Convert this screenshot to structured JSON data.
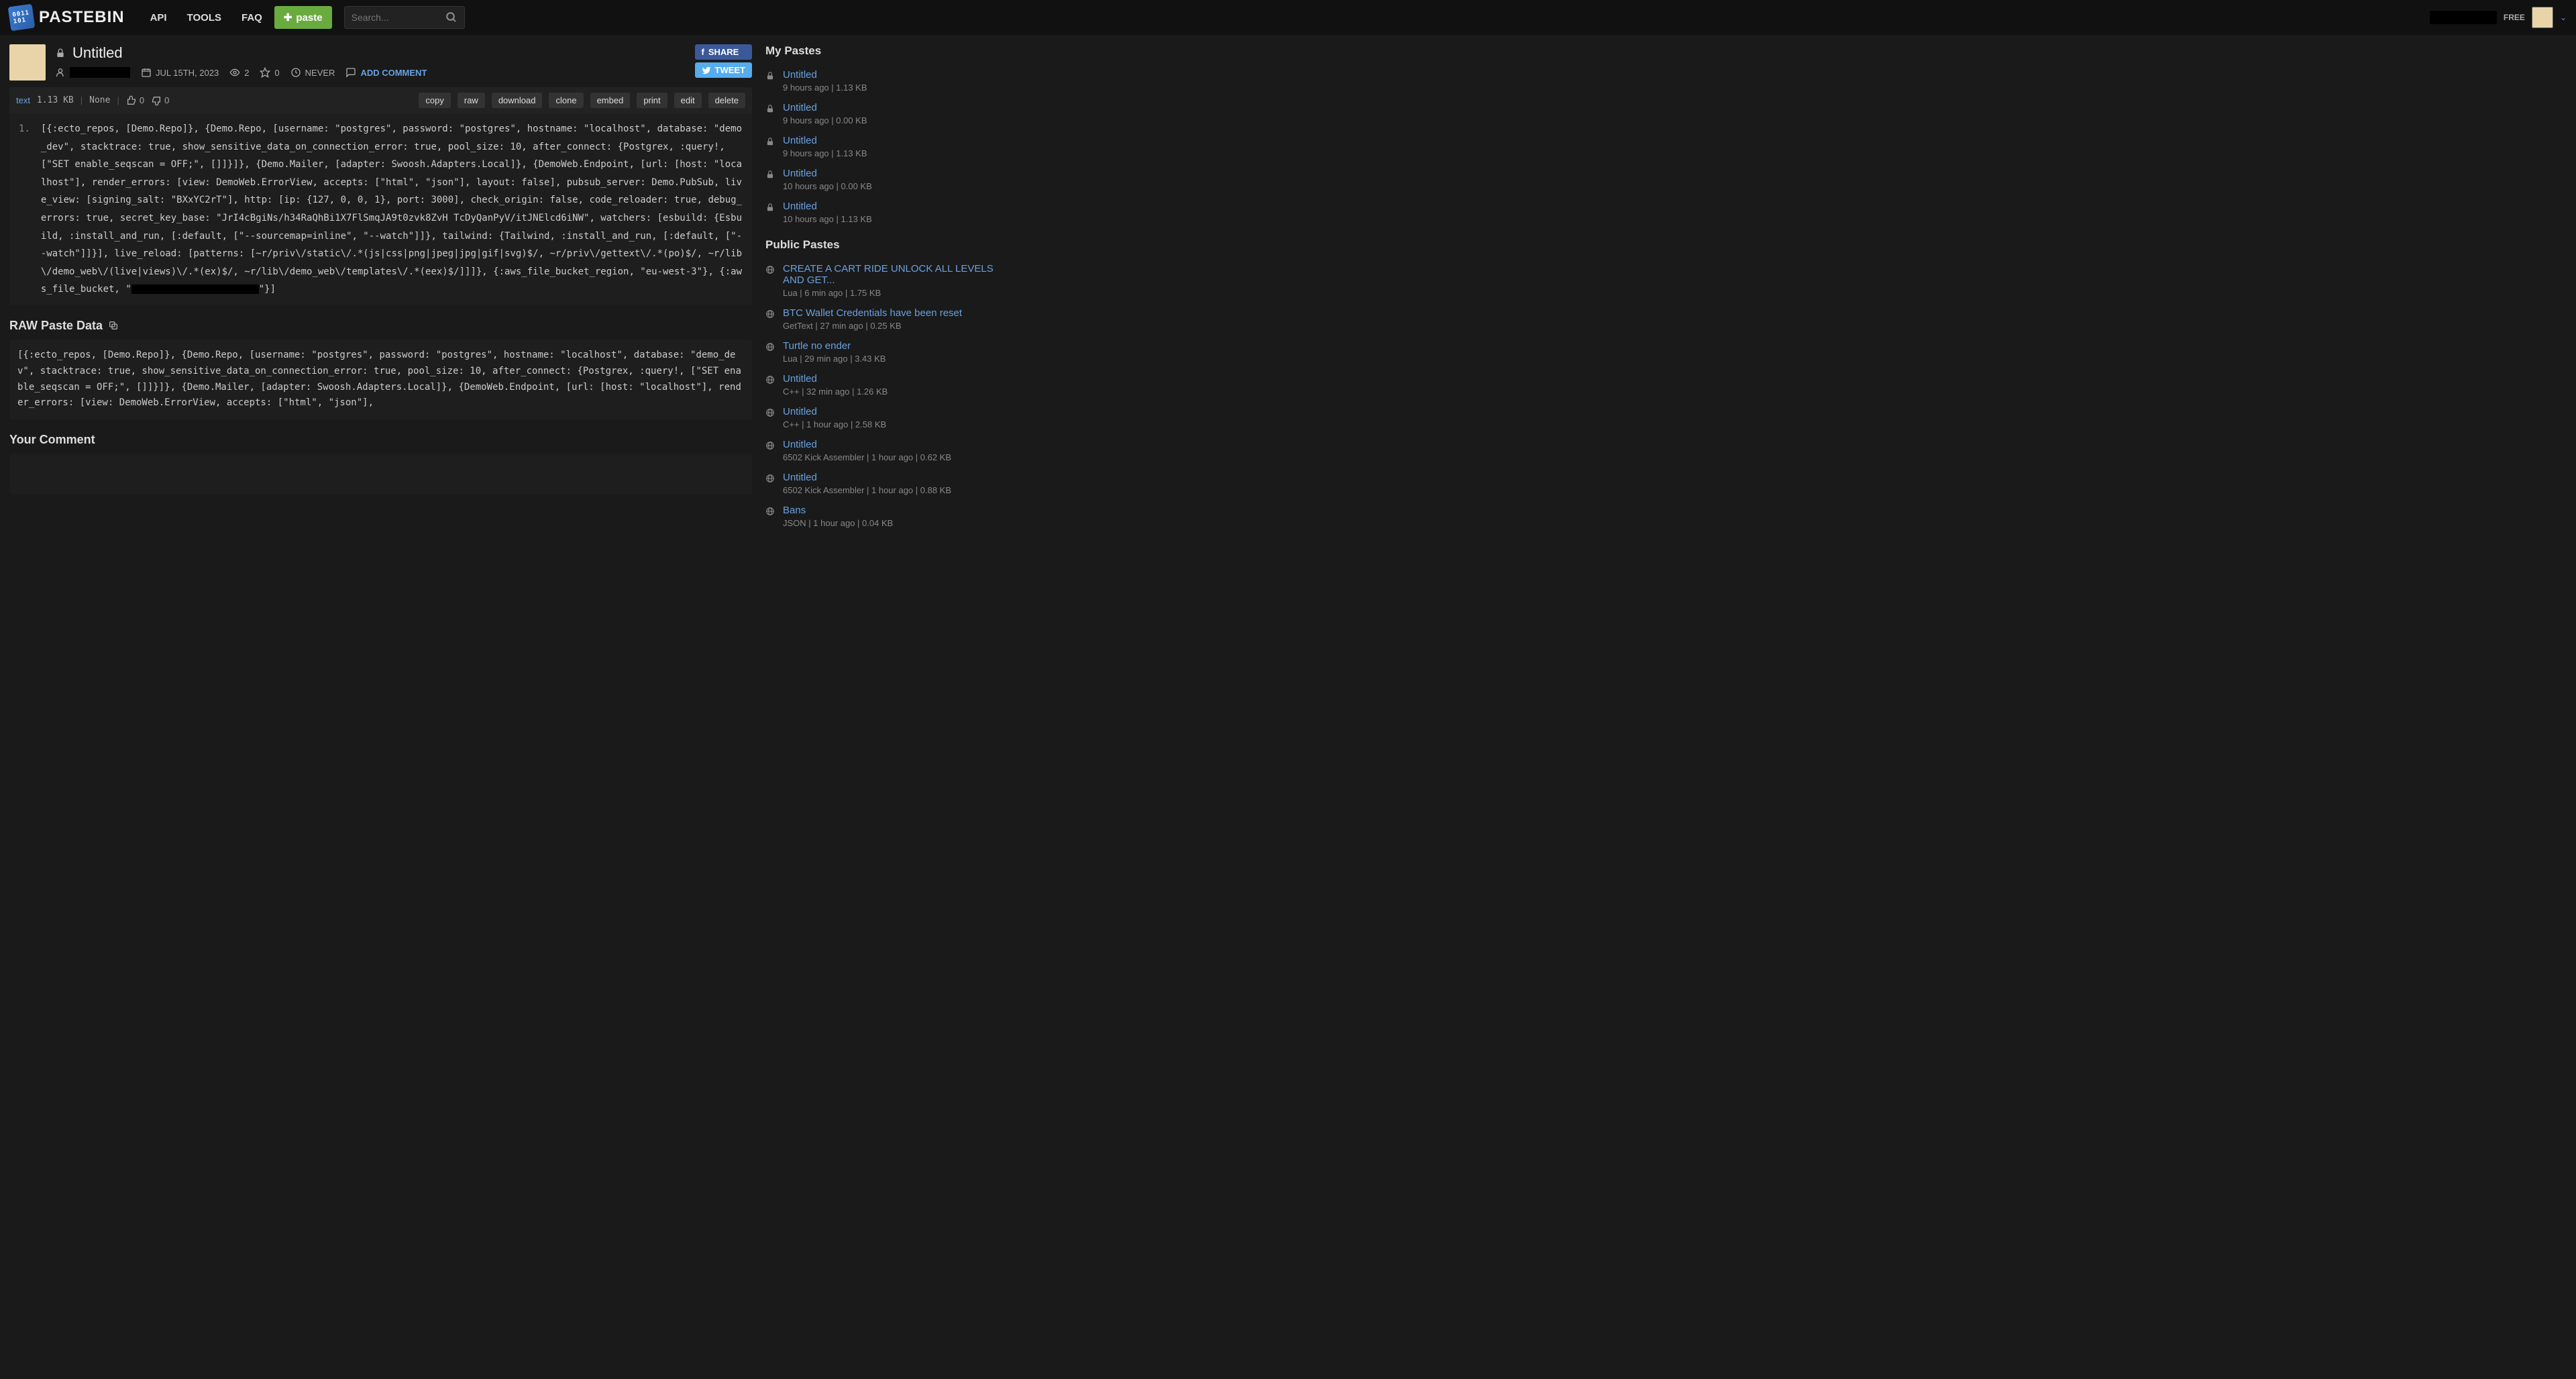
{
  "header": {
    "logo_text": "PASTEBIN",
    "nav": [
      "API",
      "TOOLS",
      "FAQ"
    ],
    "paste_btn": "paste",
    "search_placeholder": "Search...",
    "badge": "FREE"
  },
  "paste": {
    "title": "Untitled",
    "date": "JUL 15TH, 2023",
    "views": "2",
    "stars": "0",
    "expires": "NEVER",
    "add_comment": "ADD COMMENT",
    "share_fb": "SHARE",
    "share_tw": "TWEET"
  },
  "toolbar": {
    "lang": "text",
    "size": "1.13 KB",
    "category": "None",
    "thumbs_up": "0",
    "thumbs_down": "0",
    "actions": [
      "copy",
      "raw",
      "download",
      "clone",
      "embed",
      "print",
      "edit",
      "delete"
    ]
  },
  "code": {
    "line": "1.",
    "text": "[{:ecto_repos, [Demo.Repo]}, {Demo.Repo, [username: \"postgres\", password: \"postgres\", hostname: \"localhost\", database: \"demo_dev\", stacktrace: true, show_sensitive_data_on_connection_error: true, pool_size: 10, after_connect: {Postgrex, :query!, [\"SET enable_seqscan = OFF;\", []]}]}, {Demo.Mailer, [adapter: Swoosh.Adapters.Local]}, {DemoWeb.Endpoint, [url: [host: \"localhost\"], render_errors: [view: DemoWeb.ErrorView, accepts: [\"html\", \"json\"], layout: false], pubsub_server: Demo.PubSub, live_view: [signing_salt: \"BXxYC2rT\"], http: [ip: {127, 0, 0, 1}, port: 3000], check_origin: false, code_reloader: true, debug_errors: true, secret_key_base: \"JrI4cBgiNs/h34RaQhBi1X7FlSmqJA9t0zvk8ZvH TcDyQanPyV/itJNElcd6iNW\", watchers: [esbuild: {Esbuild, :install_and_run, [:default, [\"--sourcemap=inline\", \"--watch\"]]}, tailwind: {Tailwind, :install_and_run, [:default, [\"--watch\"]]}], live_reload: [patterns: [~r/priv\\/static\\/.*(js|css|png|jpeg|jpg|gif|svg)$/, ~r/priv\\/gettext\\/.*(po)$/, ~r/lib\\/demo_web\\/(live|views)\\/.*(ex)$/, ~r/lib\\/demo_web\\/templates\\/.*(eex)$/]]]}, {:aws_file_bucket_region, \"eu-west-3\"}, {:aws_file_bucket, \"",
    "text_suffix": "\"}]"
  },
  "raw": {
    "heading": "RAW Paste Data",
    "text": "[{:ecto_repos, [Demo.Repo]}, {Demo.Repo, [username: \"postgres\", password: \"postgres\", hostname: \"localhost\", database: \"demo_dev\", stacktrace: true, show_sensitive_data_on_connection_error: true, pool_size: 10, after_connect: {Postgrex, :query!, [\"SET enable_seqscan = OFF;\", []]}]}, {Demo.Mailer, [adapter: Swoosh.Adapters.Local]}, {DemoWeb.Endpoint, [url: [host: \"localhost\"], render_errors: [view: DemoWeb.ErrorView, accepts: [\"html\", \"json\"],"
  },
  "comment_heading": "Your Comment",
  "sidebar": {
    "my_heading": "My Pastes",
    "my": [
      {
        "title": "Untitled",
        "sub": "9 hours ago | 1.13 KB"
      },
      {
        "title": "Untitled",
        "sub": "9 hours ago | 0.00 KB"
      },
      {
        "title": "Untitled",
        "sub": "9 hours ago | 1.13 KB"
      },
      {
        "title": "Untitled",
        "sub": "10 hours ago | 0.00 KB"
      },
      {
        "title": "Untitled",
        "sub": "10 hours ago | 1.13 KB"
      }
    ],
    "pub_heading": "Public Pastes",
    "pub": [
      {
        "title": "CREATE A CART RIDE UNLOCK ALL LEVELS AND GET...",
        "sub": "Lua | 6 min ago | 1.75 KB"
      },
      {
        "title": "BTC Wallet Credentials have been reset",
        "sub": "GetText | 27 min ago | 0.25 KB"
      },
      {
        "title": "Turtle no ender",
        "sub": "Lua | 29 min ago | 3.43 KB"
      },
      {
        "title": "Untitled",
        "sub": "C++ | 32 min ago | 1.26 KB"
      },
      {
        "title": "Untitled",
        "sub": "C++ | 1 hour ago | 2.58 KB"
      },
      {
        "title": "Untitled",
        "sub": "6502 Kick Assembler | 1 hour ago | 0.62 KB"
      },
      {
        "title": "Untitled",
        "sub": "6502 Kick Assembler | 1 hour ago | 0.88 KB"
      },
      {
        "title": "Bans",
        "sub": "JSON | 1 hour ago | 0.04 KB"
      }
    ]
  }
}
